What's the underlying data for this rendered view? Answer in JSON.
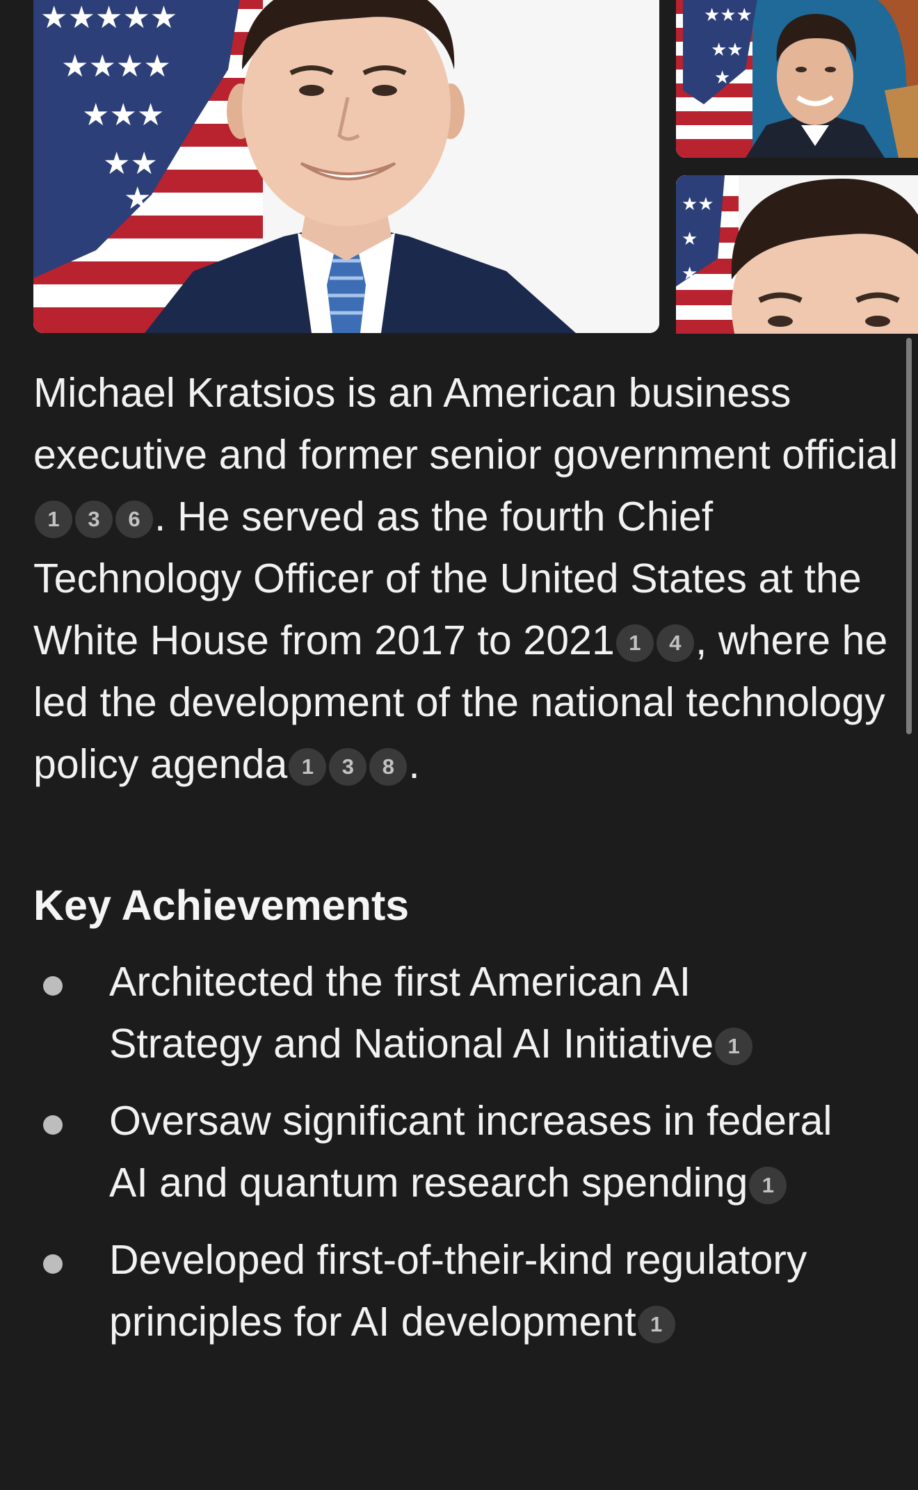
{
  "colors": {
    "background": "#1c1c1c",
    "text": "#f2f2f2",
    "citation_bg": "#3a3a3a",
    "citation_text": "#c2c2c2"
  },
  "gallery": {
    "photos": [
      {
        "name": "portrait-main"
      },
      {
        "name": "portrait-thumb-top"
      },
      {
        "name": "portrait-thumb-bottom"
      }
    ]
  },
  "summary": {
    "part1": "Michael Kratsios is an American business executive and former senior government official",
    "cites1": [
      "1",
      "3",
      "6"
    ],
    "part2": ". He served as the fourth Chief Technology Officer of the United States at the White House from 2017 to 2021",
    "cites2": [
      "1",
      "4"
    ],
    "part3": ", where he led the development of the national technology policy agenda",
    "cites3": [
      "1",
      "3",
      "8"
    ],
    "part4": "."
  },
  "key_achievements": {
    "heading": "Key Achievements",
    "items": [
      {
        "text": "Architected the first American AI Strategy and National AI Initiative",
        "cite": "1"
      },
      {
        "text": "Oversaw significant increases in federal AI and quantum research spending",
        "cite": "1"
      },
      {
        "text": "Developed first-of-their-kind regulatory principles for AI development",
        "cite": "1"
      }
    ]
  }
}
